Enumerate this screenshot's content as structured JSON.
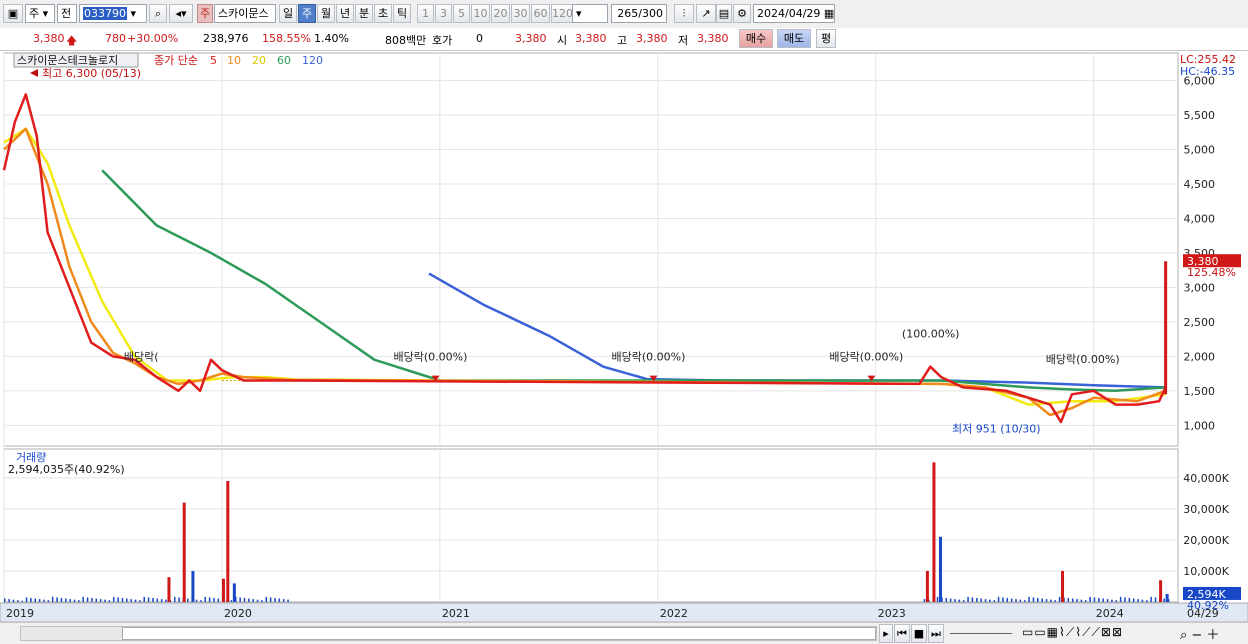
{
  "toolbar": {
    "type_label": "주",
    "market_label": "전",
    "code": "033790",
    "name_badge": "주",
    "stock_name": "스카이문스",
    "periods": [
      "일",
      "주",
      "월",
      "년",
      "분",
      "초",
      "틱"
    ],
    "selected_period": "주",
    "intervals": [
      "1",
      "3",
      "5",
      "10",
      "20",
      "30",
      "60",
      "120"
    ],
    "count": "265",
    "count_total": "/300",
    "date": "2024/04/29"
  },
  "quote": {
    "price": "3,380",
    "change": "780",
    "change_pct": "+30.00%",
    "volume": "238,976",
    "volume_pct": "158.55%",
    "turnover": "1.40%",
    "amount": "808백만",
    "hoga_label": "호가",
    "hoga_value": "0",
    "current": "3,380",
    "open_label": "시",
    "open": "3,380",
    "high_label": "고",
    "high": "3,380",
    "low_label": "저",
    "low": "3,380",
    "buy_label": "매수",
    "sell_label": "매도",
    "flat_label": "평"
  },
  "colors": {
    "up": "#d01818",
    "down": "#1848c8",
    "ma5": "#e01c1c",
    "ma10": "#f08a1c",
    "ma20": "#f2ea10",
    "ma60": "#2e9a58",
    "ma120": "#3a62d8"
  },
  "chart_data": [
    {
      "type": "line",
      "panel": "price",
      "title": "스카이문스테크놀로지",
      "legend": {
        "label": "종가 단순",
        "periods": [
          "5",
          "10",
          "20",
          "60",
          "120"
        ]
      },
      "corner_labels": [
        "LC:255.42",
        "HC:-46.35"
      ],
      "ylim": [
        700,
        6400
      ],
      "yticks": [
        "1,000",
        "1,500",
        "2,000",
        "2,500",
        "3,000",
        "3,500",
        "4,000",
        "4,500",
        "5,000",
        "5,500",
        "6,000"
      ],
      "xticks": [
        "2019",
        "2020",
        "2021",
        "2022",
        "2023",
        "2024"
      ],
      "last_x_label": "04/29",
      "last_price_label": "3,380",
      "last_price_pct": "125.48%",
      "high_annotation": "최고 6,300 (05/13)",
      "low_annotation": "최저 951 (10/30)",
      "dividend_label": "배당락(0.00%)",
      "dividend_partial_label": "배당락(",
      "dividend_pct_100": "(100.00%)",
      "series": [
        {
          "name": "5",
          "x": [
            2019.0,
            2019.05,
            2019.1,
            2019.15,
            2019.2,
            2019.3,
            2019.4,
            2019.5,
            2019.6,
            2019.7,
            2019.75,
            2019.8,
            2019.85,
            2019.9,
            2019.95,
            2020.0,
            2020.1,
            2020.3,
            2023.2,
            2023.25,
            2023.3,
            2023.4,
            2023.6,
            2023.8,
            2023.85,
            2023.9,
            2024.0,
            2024.1,
            2024.2,
            2024.3,
            2024.33
          ],
          "y": [
            4700,
            5400,
            5800,
            5200,
            3800,
            3000,
            2200,
            2000,
            1950,
            1700,
            1600,
            1500,
            1650,
            1500,
            1950,
            1800,
            1650,
            1650,
            1600,
            1850,
            1700,
            1550,
            1500,
            1300,
            1050,
            1450,
            1500,
            1300,
            1300,
            1350,
            1550
          ]
        },
        {
          "name": "10",
          "x": [
            2019.0,
            2019.1,
            2019.2,
            2019.3,
            2019.4,
            2019.5,
            2019.6,
            2019.7,
            2019.8,
            2019.9,
            2020.0,
            2020.1,
            2020.3,
            2023.3,
            2023.5,
            2023.7,
            2023.8,
            2023.9,
            2024.0,
            2024.2,
            2024.33
          ],
          "y": [
            5000,
            5300,
            4500,
            3300,
            2500,
            2050,
            1900,
            1700,
            1600,
            1650,
            1750,
            1700,
            1660,
            1600,
            1550,
            1400,
            1150,
            1250,
            1400,
            1350,
            1500
          ]
        },
        {
          "name": "20",
          "x": [
            2019.0,
            2019.1,
            2019.2,
            2019.3,
            2019.45,
            2019.6,
            2019.75,
            2019.9,
            2020.05,
            2020.2,
            2020.35,
            2020.5,
            2023.3,
            2023.5,
            2023.7,
            2023.9,
            2024.1,
            2024.33
          ],
          "y": [
            5100,
            5300,
            4800,
            3900,
            2800,
            2000,
            1650,
            1650,
            1700,
            1700,
            1660,
            1660,
            1600,
            1550,
            1300,
            1350,
            1350,
            1450
          ]
        },
        {
          "name": "60",
          "x": [
            2019.45,
            2019.7,
            2019.95,
            2020.2,
            2020.45,
            2020.7,
            2021.0,
            2023.3,
            2023.7,
            2023.9,
            2024.1,
            2024.33
          ],
          "y": [
            4700,
            3900,
            3500,
            3050,
            2500,
            1950,
            1650,
            1650,
            1550,
            1520,
            1500,
            1550
          ]
        },
        {
          "name": "120",
          "x": [
            2020.95,
            2021.2,
            2021.5,
            2021.75,
            2021.95,
            2022.3,
            2023.3,
            2023.7,
            2024.0,
            2024.33
          ],
          "y": [
            3200,
            2750,
            2300,
            1850,
            1670,
            1650,
            1650,
            1620,
            1580,
            1550
          ]
        }
      ]
    },
    {
      "type": "bar",
      "panel": "volume",
      "title": "거래량",
      "subtitle": "2,594,035주(40.92%)",
      "ylim": [
        0,
        48000
      ],
      "yticks": [
        "10,000K",
        "20,000K",
        "30,000K",
        "40,000K"
      ],
      "last_label": "2,594K",
      "last_pct": "40.92%",
      "spikes": [
        {
          "x": 2019.75,
          "value": 8000
        },
        {
          "x": 2019.82,
          "value": 32000
        },
        {
          "x": 2019.86,
          "value": 10000
        },
        {
          "x": 2020.0,
          "value": 7500
        },
        {
          "x": 2020.02,
          "value": 39000
        },
        {
          "x": 2020.05,
          "value": 6000
        },
        {
          "x": 2023.23,
          "value": 10000
        },
        {
          "x": 2023.26,
          "value": 45000
        },
        {
          "x": 2023.29,
          "value": 21000
        },
        {
          "x": 2023.85,
          "value": 10000
        },
        {
          "x": 2024.3,
          "value": 7000
        },
        {
          "x": 2024.33,
          "value": 2594
        }
      ]
    }
  ]
}
